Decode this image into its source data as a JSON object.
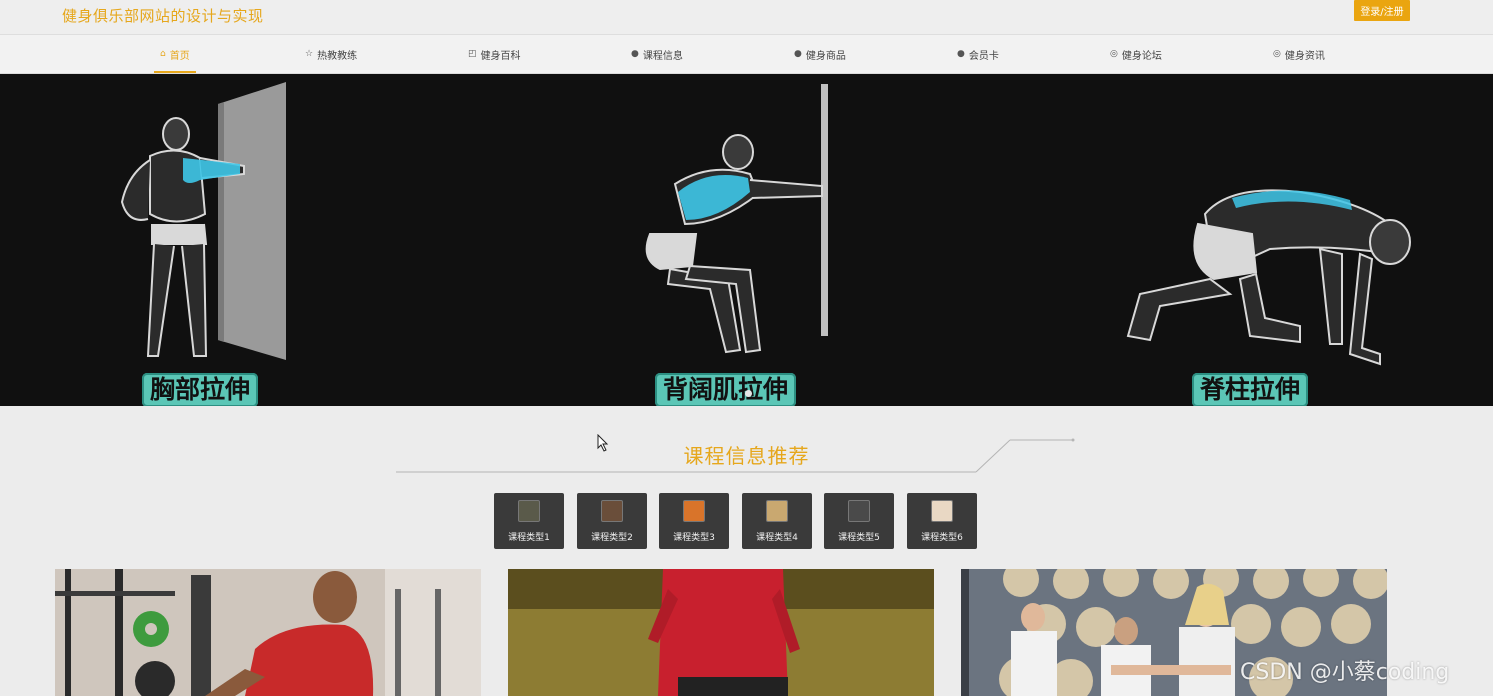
{
  "header": {
    "site_title": "健身俱乐部网站的设计与实现",
    "login_label": "登录/注册"
  },
  "nav": {
    "items": [
      {
        "label": "首页",
        "icon": "home-icon",
        "glyph": "⌂",
        "active": true
      },
      {
        "label": "热教教练",
        "icon": "star-icon",
        "glyph": "☆",
        "active": false
      },
      {
        "label": "健身百科",
        "icon": "bag-icon",
        "glyph": "◰",
        "active": false
      },
      {
        "label": "课程信息",
        "icon": "info-icon",
        "glyph": "●",
        "active": false
      },
      {
        "label": "健身商品",
        "icon": "question-icon",
        "glyph": "●",
        "active": false
      },
      {
        "label": "会员卡",
        "icon": "card-icon",
        "glyph": "●",
        "active": false
      },
      {
        "label": "健身论坛",
        "icon": "forum-icon",
        "glyph": "◎",
        "active": false
      },
      {
        "label": "健身资讯",
        "icon": "news-icon",
        "glyph": "◎",
        "active": false
      }
    ]
  },
  "banner": {
    "labels": [
      "胸部拉伸",
      "背阔肌拉伸",
      "脊柱拉伸"
    ],
    "highlight_color": "#3ec6e8",
    "label_bg": "#5bc6b6"
  },
  "section": {
    "title": "课程信息推荐"
  },
  "categories": [
    {
      "label": "课程类型1",
      "thumb_color": "#5a5a4a"
    },
    {
      "label": "课程类型2",
      "thumb_color": "#6a4e3a"
    },
    {
      "label": "课程类型3",
      "thumb_color": "#d9742a"
    },
    {
      "label": "课程类型4",
      "thumb_color": "#c9a870"
    },
    {
      "label": "课程类型5",
      "thumb_color": "#4a4a4a"
    },
    {
      "label": "课程类型6",
      "thumb_color": "#e9d8c4"
    }
  ],
  "watermark": "CSDN @小蔡coding",
  "colors": {
    "accent": "#e6a71c",
    "login_bg": "#eaa510",
    "category_bg": "#3a3a3a",
    "banner_bg": "#101010"
  }
}
